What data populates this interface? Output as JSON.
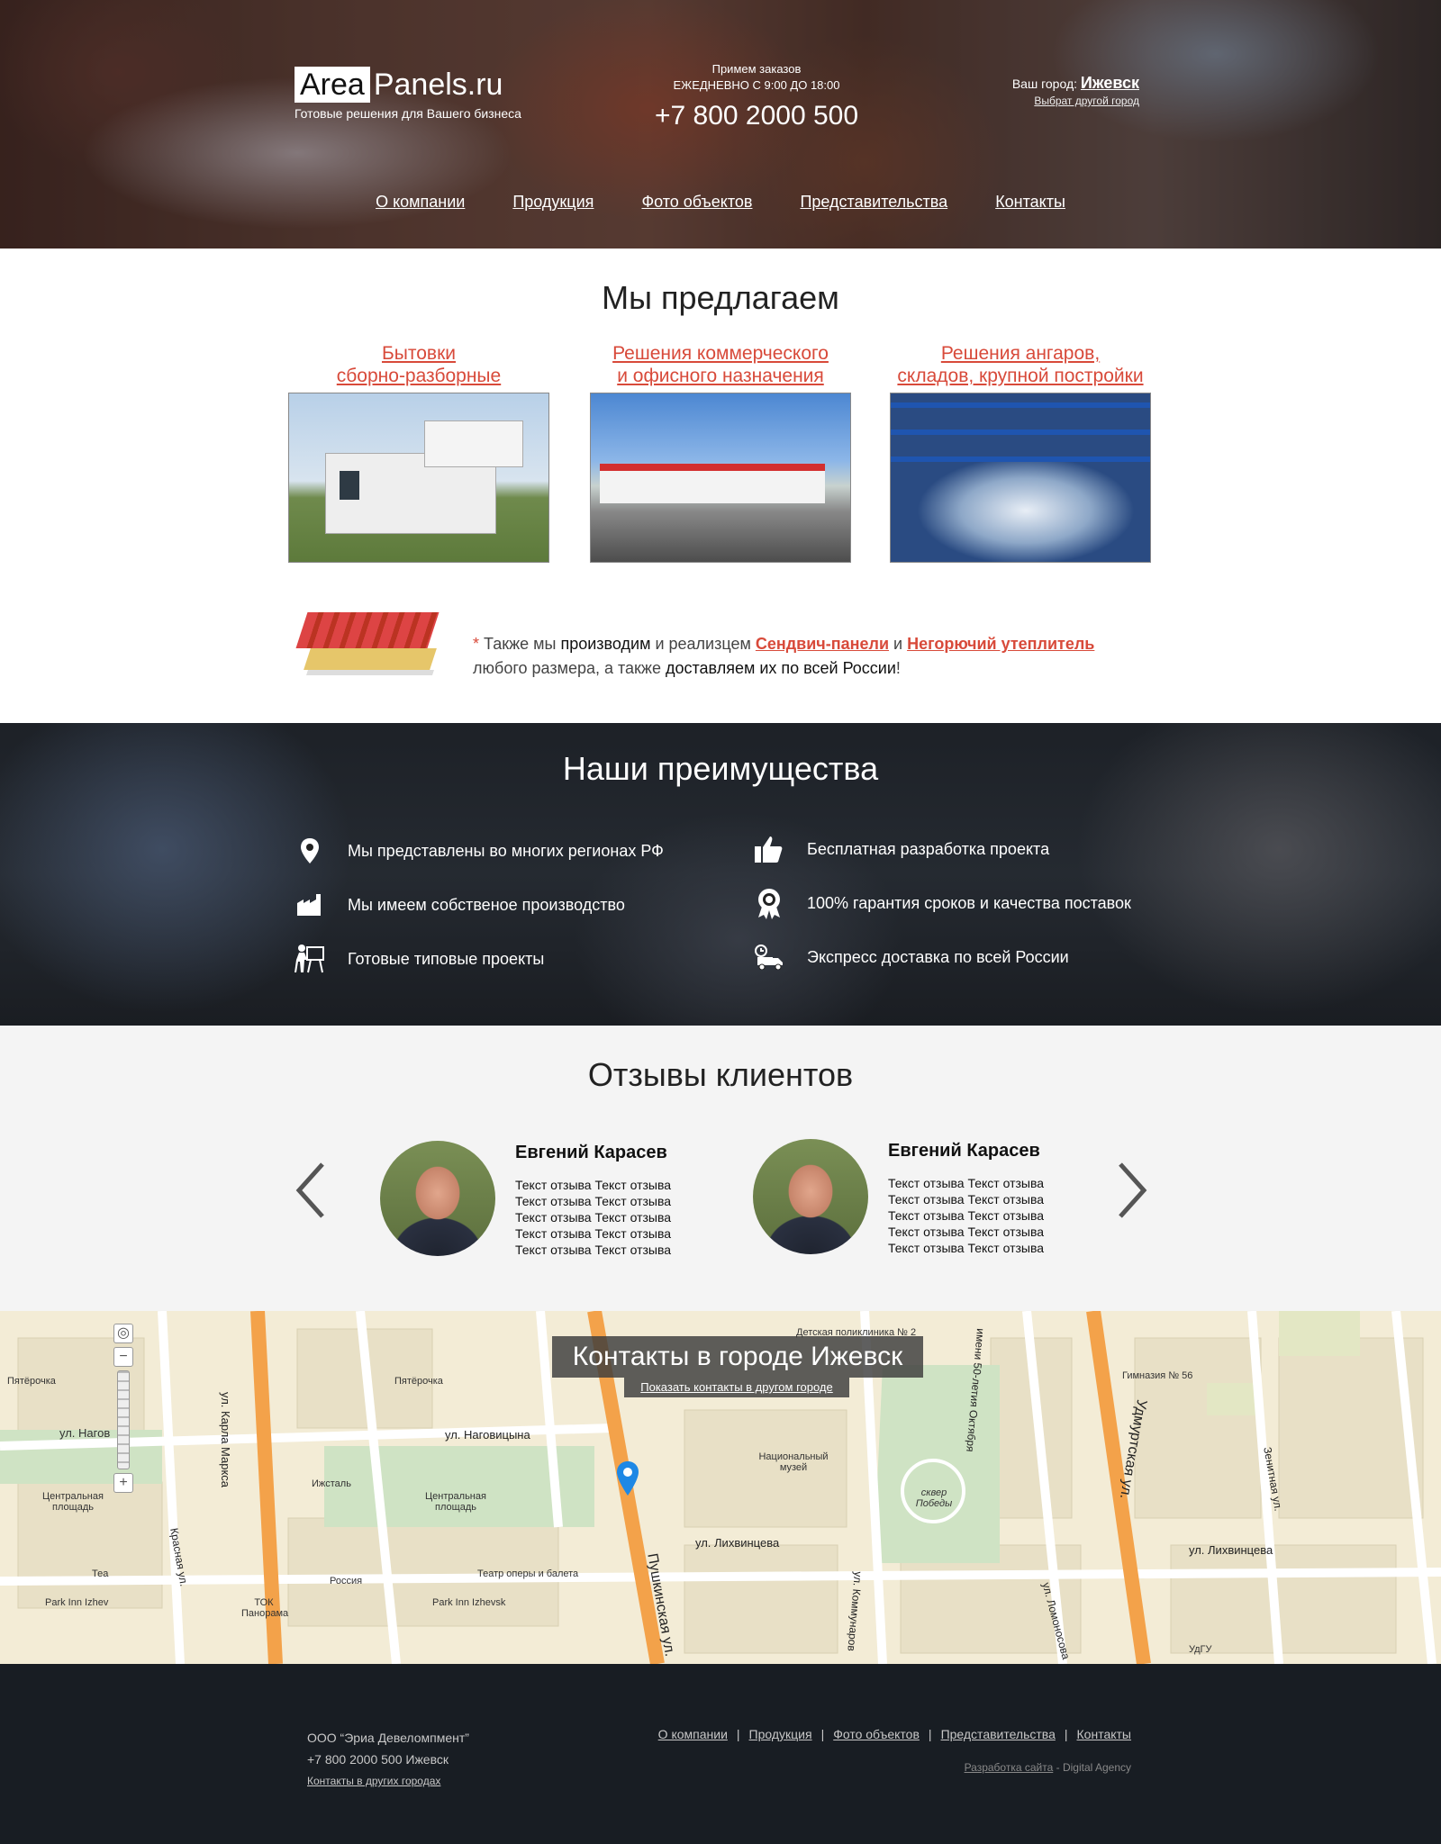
{
  "header": {
    "logo_box": "Area",
    "logo_rest": "Panels.ru",
    "tagline": "Готовые решения для Вашего бизнеса",
    "hours_line1": "Примем заказов",
    "hours_line2": "ЕЖЕДНЕВНО С 9:00 ДО 18:00",
    "phone": "+7 800 2000 500",
    "city_label": "Ваш город:",
    "city_name": "Ижевск",
    "city_change": "Выбрат другой город"
  },
  "nav": [
    {
      "label": "О компании"
    },
    {
      "label": "Продукция"
    },
    {
      "label": "Фото объектов"
    },
    {
      "label": "Представительства"
    },
    {
      "label": "Контакты"
    }
  ],
  "offer": {
    "title": "Мы предлагаем",
    "cards": [
      {
        "line1": "Бытовки",
        "line2": "сборно-разборные"
      },
      {
        "line1": "Решения коммерческого",
        "line2": "и офисного назначения"
      },
      {
        "line1": "Решения ангаров,",
        "line2": "складов, крупной постройки"
      }
    ],
    "note": {
      "star": "*",
      "p1": " Также мы ",
      "p2": "производим",
      "p3": " и реализцем ",
      "link1": "Сендвич-панели",
      "p4": " и ",
      "link2": "Негорючий утеплитель",
      "p5": "любого размера, а также ",
      "p6": "доставляем их по всей России",
      "p7": "!"
    }
  },
  "advantages": {
    "title": "Наши преимущества",
    "items": [
      {
        "text": "Мы представлены во многих регионах РФ",
        "icon": "map-pin-icon"
      },
      {
        "text": "Мы имеем собственое производство",
        "icon": "factory-icon"
      },
      {
        "text": "Готовые типовые проекты",
        "icon": "presenter-icon"
      },
      {
        "text": "Бесплатная разработка проекта",
        "icon": "thumbs-up-icon"
      },
      {
        "text": "100% гарантия сроков и качества поставок",
        "icon": "award-icon"
      },
      {
        "text": "Экспресс доставка по всей России",
        "icon": "delivery-truck-icon"
      }
    ]
  },
  "reviews": {
    "title": "Отзывы клиентов",
    "items": [
      {
        "name": "Евгений Карасев",
        "text": "Текст отзыва Текст отзыва Текст отзыва Текст отзыва Текст отзыва Текст отзыва Текст отзыва Текст отзыва Текст отзыва Текст отзыва"
      },
      {
        "name": "Евгений Карасев",
        "text": "Текст отзыва Текст отзыва Текст отзыва Текст отзыва Текст отзыва Текст отзыва Текст отзыва Текст отзыва Текст отзыва Текст отзыва"
      }
    ]
  },
  "map": {
    "title": "Контакты в городе Ижевск",
    "link": "Показать контакты в другом городе",
    "streets": [
      "ул. Карла Маркса",
      "Пушкинская ул.",
      "Удмуртская ул.",
      "ул. Наговицына",
      "ул. Лихвинцева",
      "ул. Лихвинцева",
      "Красная ул.",
      "ул. Коммунаров",
      "ул. Ломоносова",
      "Зенитная ул.",
      "имени 50-летия Октября"
    ],
    "places": [
      "Пятёрочка",
      "Пятёрочка",
      "Центральная площадь",
      "Центральная площадь",
      "Ижсталь",
      "Национальный музей",
      "сквер Победы",
      "Гимназия № 56",
      "Детская поликлиника № 2",
      "Театр оперы и балета",
      "Россия",
      "Park Inn Izhev",
      "Park Inn Izhevsk",
      "ТОК Панорама",
      "Теа",
      "УдГУ",
      "ул. Нагов"
    ]
  },
  "footer": {
    "company": "ООО “Эриа Девеломпмент”",
    "phone": "+7 800 2000 500 Ижевск",
    "other_cities": "Контакты в других городах",
    "nav": [
      "О компании",
      "Продукция",
      "Фото объектов",
      "Представительства",
      "Контакты"
    ],
    "dev_link": "Разработка сайта",
    "dev_sep": " - ",
    "dev_agency": "Digital Agency"
  }
}
